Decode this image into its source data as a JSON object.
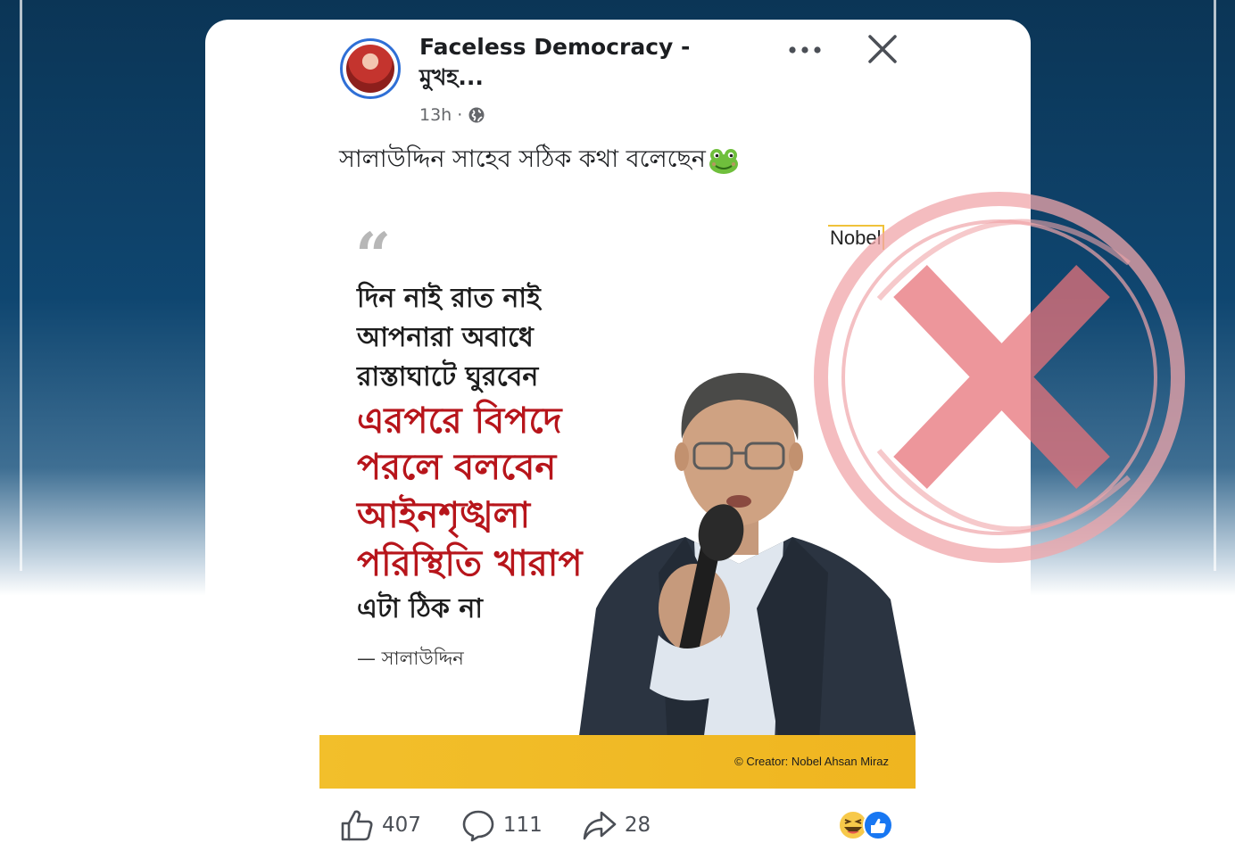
{
  "background": {
    "watermark": "",
    "color": "#0f4670"
  },
  "post": {
    "page_name": "Faceless Democracy - মুখহ...",
    "time": "13h",
    "time_separator": "·",
    "caption": "সালাউদ্দিন সাহেব সঠিক কথা বলেছেন",
    "more_icon": "more-horizontal-icon",
    "close_icon": "close-icon"
  },
  "image": {
    "logo": "Nobel",
    "quote_lines_black": [
      "দিন নাই রাত নাই",
      "আপনারা অবাধে",
      "রাস্তাঘাটে ঘুরবেন"
    ],
    "quote_lines_red": [
      "এরপরে বিপদে",
      "পরলে বলবেন",
      "আইনশৃঙ্খলা",
      "পরিস্থিতি খারাপ"
    ],
    "quote_tail": "এটা ঠিক না",
    "attribution": "— সালাউদ্দিন",
    "credit": "© Creator: Nobel Ahsan Miraz",
    "accent_color": "#b7151b",
    "bar_color": "#f2bf2b"
  },
  "reactions": {
    "likes": "407",
    "comments": "111",
    "shares": "28",
    "reaction_types": [
      "haha-icon",
      "like-icon"
    ]
  },
  "stamp": {
    "type": "rejected-cross-stamp",
    "color": "#e8737a"
  }
}
